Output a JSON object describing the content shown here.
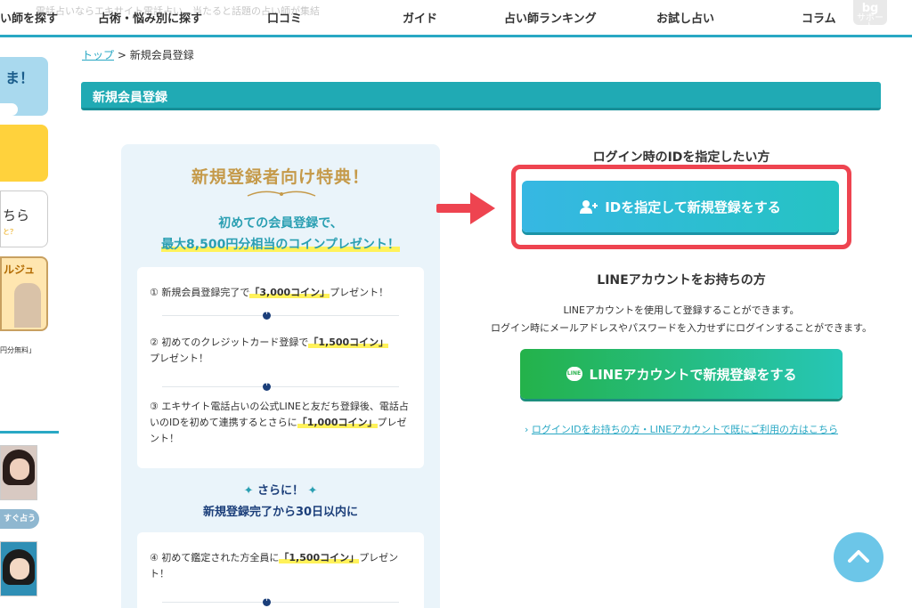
{
  "topnav": {
    "ticker": "電話占いならエキサイト電話占い…当たると話題の占い師が集結",
    "items": [
      "い師を探す",
      "占術・悩み別に探す",
      "口コミ",
      "ガイド",
      "占い師ランキング",
      "お試し占い",
      "コラム"
    ],
    "support_top": "bg",
    "support_label": "サポート"
  },
  "sidebar": {
    "card1_text": "ま！",
    "card3_text": "ちら",
    "card3_sub": "と？",
    "card4_text": "ルジュ",
    "note": "円分無料」",
    "button_label": "すぐ占う"
  },
  "breadcrumb": {
    "home": "トップ",
    "separator": ">",
    "current": "新規会員登録"
  },
  "section": {
    "title": "新規会員登録"
  },
  "benefit": {
    "title": "新規登録者向け特典！",
    "lead1": "初めての会員登録で、",
    "lead2": "最大8,500円分相当のコインプレゼント！",
    "item1_pre": "① 新規会員登録完了で",
    "item1_hl": "「3,000コイン」",
    "item1_post": "プレゼント！",
    "item2_pre": "② 初めてのクレジットカード登録で",
    "item2_hl": "「1,500コイン」",
    "item2_post": "プレゼント！",
    "item3_pre": "③ エキサイト電話占いの公式LINEと友だち登録後、電話占いのIDを初めて連携するとさらに",
    "item3_hl": "「1,000コイン」",
    "item3_post": "プレゼント！",
    "sarani": "さらに！",
    "within": "新規登録完了から30日以内に",
    "item4_pre": "④ 初めて鑑定された方全員に",
    "item4_hl": "「1,500コイン」",
    "item4_post": "プレゼント！"
  },
  "right": {
    "id_heading": "ログイン時のIDを指定したい方",
    "id_button": "IDを指定して新規登録をする",
    "line_heading": "LINEアカウントをお持ちの方",
    "line_desc1": "LINEアカウントを使用して登録することができます。",
    "line_desc2": "ログイン時にメールアドレスやパスワードを入力せずにログインすることができます。",
    "line_icon_text": "LINE",
    "line_button": "LINEアカウントで新規登録をする",
    "login_link": "ログインIDをお持ちの方・LINEアカウントで既にご利用の方はこちら"
  },
  "colors": {
    "accent": "#20aab4",
    "highlight_frame": "#ee4450",
    "line_green": "#24b24a",
    "link": "#29a8c4"
  }
}
